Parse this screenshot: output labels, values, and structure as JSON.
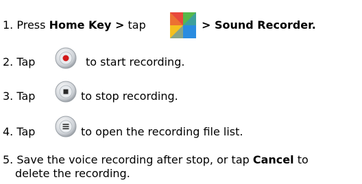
{
  "steps": [
    {
      "number": "1.",
      "text_a": "Press",
      "bold_a": "Home Key >",
      "text_b": "tap",
      "icon": "app-drawer-icon",
      "bold_b": "> Sound Recorder."
    },
    {
      "number": "2.",
      "text_a": "Tap",
      "icon": "record-button-icon",
      "text_b": "to start recording."
    },
    {
      "number": "3.",
      "text_a": "Tap",
      "icon": "stop-button-icon",
      "text_b": "to stop recording."
    },
    {
      "number": "4.",
      "text_a": "Tap",
      "icon": "list-button-icon",
      "text_b": "to open the recording file list."
    },
    {
      "number": "5.",
      "text_a": "Save the voice recording after stop, or tap",
      "bold_a": "Cancel",
      "text_b": "to",
      "text_c": "delete the recording."
    }
  ],
  "colors": {
    "record_red": "#d21a1a",
    "drawer_red": "#e8483c",
    "drawer_green": "#56b84a",
    "drawer_yellow": "#f4c020",
    "drawer_blue": "#2a8ce0"
  }
}
